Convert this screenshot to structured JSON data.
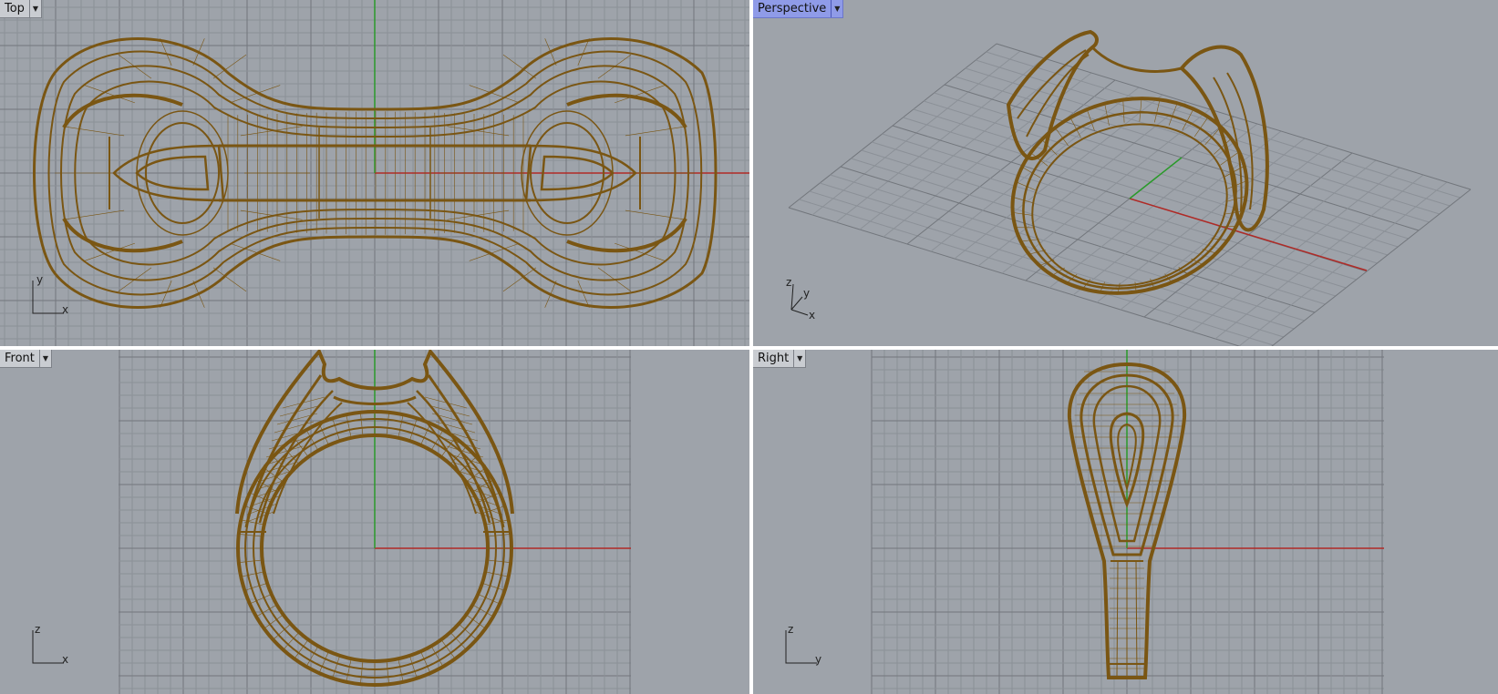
{
  "viewports": {
    "top": {
      "name": "Top",
      "axis_a": "y",
      "axis_b": "x"
    },
    "perspective": {
      "name": "Perspective",
      "axis_a": "z",
      "axis_b": "y",
      "axis_c": "x"
    },
    "front": {
      "name": "Front",
      "axis_a": "z",
      "axis_b": "x"
    },
    "right": {
      "name": "Right",
      "axis_a": "z",
      "axis_b": "y"
    }
  },
  "icons": {
    "dropdown": "dropdown-arrow-icon"
  },
  "colors": {
    "viewport_bg": "#9ea3aa",
    "grid_minor": "#8b9097",
    "grid_major": "#72767c",
    "x_axis": "#b02a26",
    "y_axis": "#2a9a2a",
    "wireframe": "#7a5613",
    "active_tab": "#8f9be8"
  }
}
